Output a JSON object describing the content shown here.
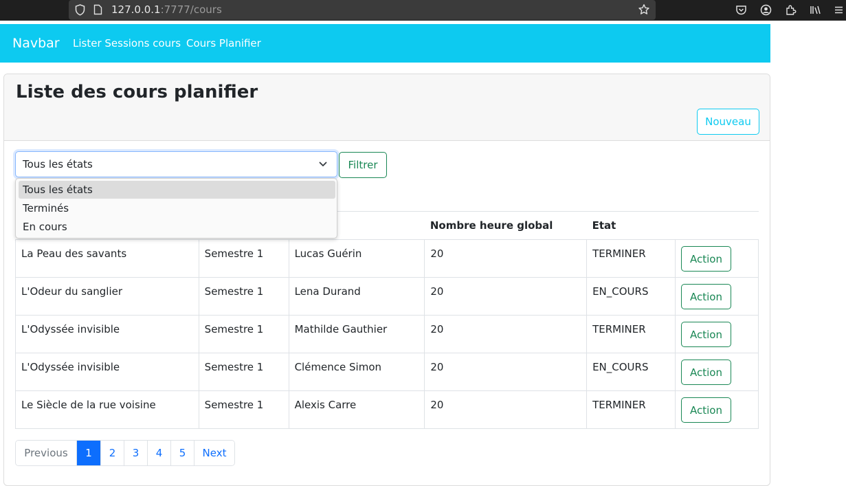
{
  "browser": {
    "url_host": "127.0.0.1",
    "url_path": ":7777/cours"
  },
  "navbar": {
    "brand": "Navbar",
    "links": [
      {
        "label": "Lister Sessions cours"
      },
      {
        "label": "Cours Planifier"
      }
    ]
  },
  "card": {
    "title": "Liste des cours planifier",
    "new_button": "Nouveau"
  },
  "filter": {
    "selected": "Tous les états",
    "options": [
      "Tous les états",
      "Terminés",
      "En cours"
    ],
    "highlighted_index": 0,
    "button": "Filtrer"
  },
  "table": {
    "headers": [
      "",
      "",
      "eur",
      "Nombre heure global",
      "Etat",
      ""
    ],
    "rows": [
      {
        "title": "La Peau des savants",
        "semestre": "Semestre 1",
        "professeur": "Lucas Guérin",
        "heures": "20",
        "etat": "TERMINER",
        "action": "Action"
      },
      {
        "title": "L'Odeur du sanglier",
        "semestre": "Semestre 1",
        "professeur": "Lena Durand",
        "heures": "20",
        "etat": "EN_COURS",
        "action": "Action"
      },
      {
        "title": "L'Odyssée invisible",
        "semestre": "Semestre 1",
        "professeur": "Mathilde Gauthier",
        "heures": "20",
        "etat": "TERMINER",
        "action": "Action"
      },
      {
        "title": "L'Odyssée invisible",
        "semestre": "Semestre 1",
        "professeur": "Clémence Simon",
        "heures": "20",
        "etat": "EN_COURS",
        "action": "Action"
      },
      {
        "title": "Le Siècle de la rue voisine",
        "semestre": "Semestre 1",
        "professeur": "Alexis Carre",
        "heures": "20",
        "etat": "TERMINER",
        "action": "Action"
      }
    ]
  },
  "pagination": {
    "previous": "Previous",
    "pages": [
      "1",
      "2",
      "3",
      "4",
      "5"
    ],
    "active": "1",
    "next": "Next"
  },
  "colors": {
    "navbar": "#0dcaf0",
    "success": "#198754",
    "primary": "#0d6efd",
    "info": "#0dcaf0"
  },
  "icons": {
    "toolbar": [
      "pocket-icon",
      "account-icon",
      "extensions-icon",
      "library-icon",
      "menu-icon"
    ]
  }
}
